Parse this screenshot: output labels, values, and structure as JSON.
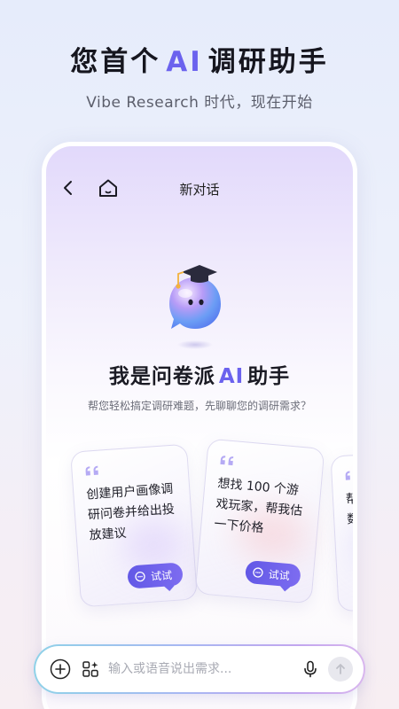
{
  "promo": {
    "title_left": "您首个",
    "title_ai": "AI",
    "title_right": "调研助手",
    "subtitle": "Vibe Research 时代，现在开始"
  },
  "nav": {
    "back_icon": "chevron-left-icon",
    "home_icon": "home-icon",
    "title": "新对话"
  },
  "hero": {
    "mascot": "graduate-bubble-mascot",
    "title_left": "我是问卷派",
    "title_ai": "AI",
    "title_right": "助手",
    "subtitle": "帮您轻松搞定调研难题，先聊聊您的调研需求？"
  },
  "cards": [
    {
      "text": "创建用户画像调研问卷并给出投放建议",
      "button": "试试"
    },
    {
      "text": "想找 100 个游戏玩家，帮我估一下价格",
      "button": "试试"
    },
    {
      "text": "帮我分析Excel数据洞察结论"
    }
  ],
  "input": {
    "placeholder": "输入或语音说出需求...",
    "plus_icon": "plus-icon",
    "apps_icon": "apps-sparkle-icon",
    "mic_icon": "microphone-icon",
    "send_icon": "arrow-up-icon"
  },
  "colors": {
    "accent": "#6b62ee",
    "button": "#6258e6",
    "title": "#16161f",
    "subtitle": "#5c5f6c"
  }
}
